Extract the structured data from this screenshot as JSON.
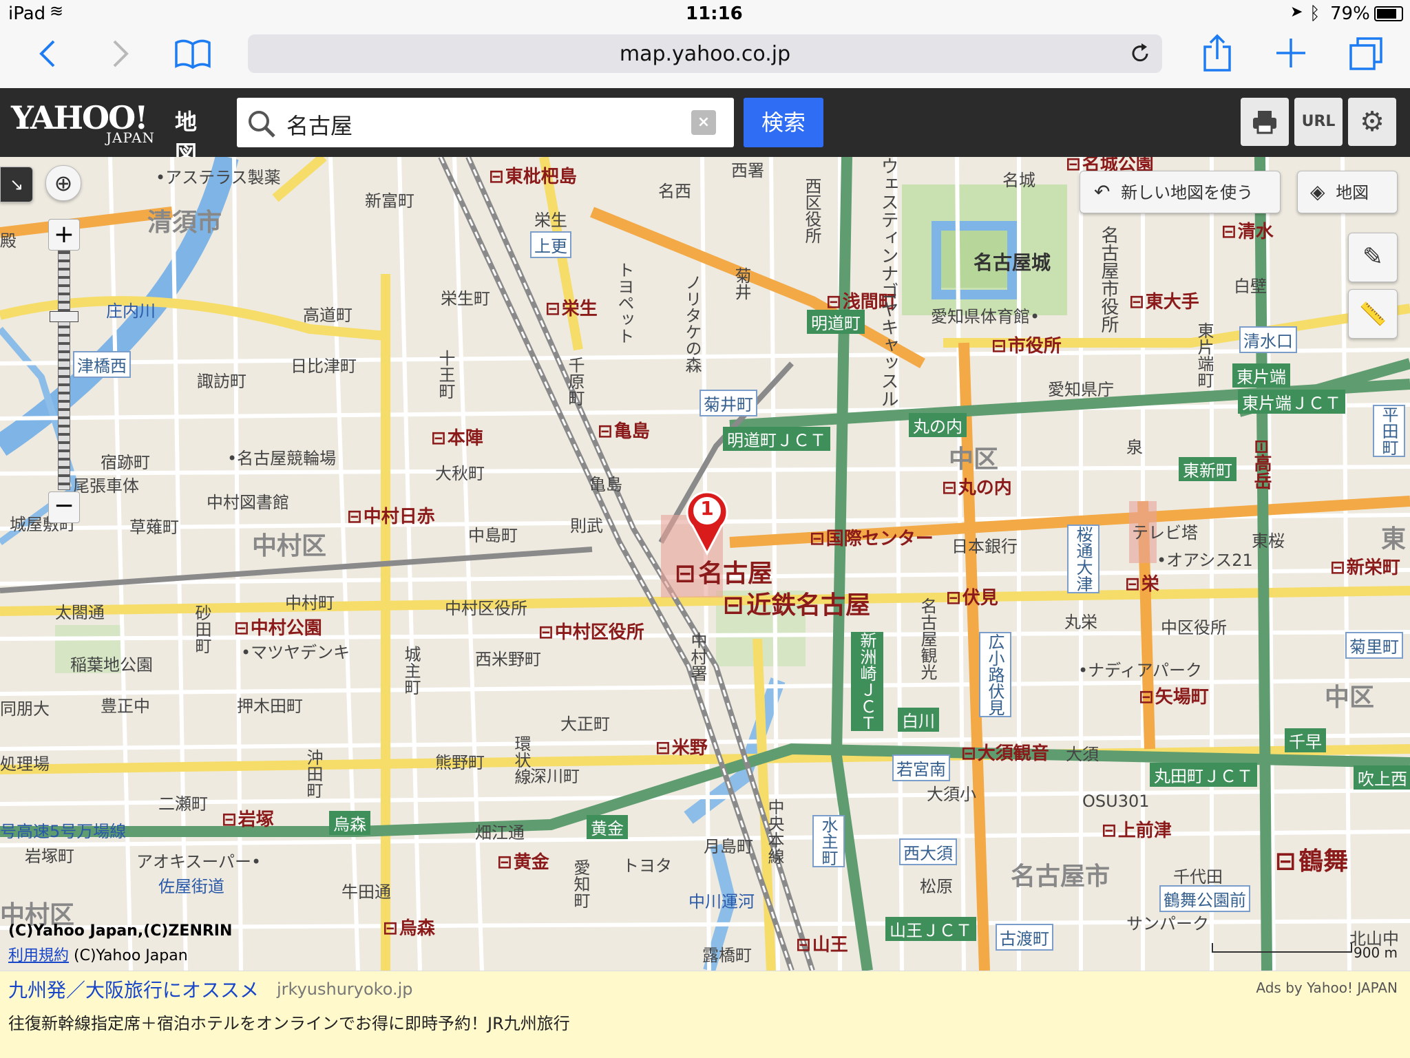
{
  "status_bar": {
    "device": "iPad",
    "time": "11:16",
    "battery": "79%"
  },
  "browser": {
    "url": "map.yahoo.co.jp"
  },
  "header": {
    "logo": "YAHOO!",
    "logo_sub": "JAPAN",
    "logo_service": "地図",
    "search_value": "名古屋",
    "clear_label": "×",
    "search_button": "検索",
    "url_button": "URL"
  },
  "map": {
    "new_map_button": "新しい地図を使う",
    "layer_button": "地図",
    "marker_number": "1",
    "scale": "900 m",
    "copyright_1": "(C)Yahoo Japan,(C)ZENRIN",
    "terms_link": "利用規約",
    "copyright_2": "(C)Yahoo Japan",
    "labels": {
      "asteras": "•アステラス製薬",
      "higashi_biwajima": "東枇杷島",
      "kiyosu": "清須市",
      "shintomi": "新富町",
      "meisei": "名西",
      "eisei": "栄生",
      "kamisara": "上更",
      "nishiku_yakusho": "西区役所",
      "nishisho": "西署",
      "meijo": "名城",
      "shiroshirou": "名古屋城",
      "meijo_sta": "名城公園",
      "shimizu": "清水",
      "shirakabe": "白壁",
      "shimizuguchi": "清水口",
      "higashiote": "東大手",
      "shiyakusho": "市役所",
      "nagoya_shiyakusho": "名古屋市役所",
      "aichi_gym": "愛知県体育館•",
      "aichi_pref": "愛知県庁",
      "sengencho": "浅間町",
      "meidocho": "明道町",
      "eiseicho": "栄生町",
      "eisei_sta": "栄生",
      "takamichi": "高道町",
      "shonaigawa": "庄内川",
      "tsubashinishi": "津橋西",
      "hibitsu": "日比津町",
      "suwa": "諏訪町",
      "kikui": "菊井町",
      "kikui_v": "菊井",
      "noritake": "ノリタケの森",
      "toyopet": "トヨペット",
      "jujicho": "十王町",
      "senbara": "千原町",
      "honjin": "本陣",
      "kameshima_sta": "亀島",
      "kameshima": "亀島",
      "meidocho_jct": "明道町ＪＣＴ",
      "marunouchi": "丸の内",
      "marunouchi_sta": "丸の内",
      "naka_ku": "中区",
      "higashikataha": "東片端",
      "higashikataha_jct": "東片端ＪＣＴ",
      "shukuato": "宿跡町",
      "keirinjo": "•名古屋競輪場",
      "ohakicho": "大秋町",
      "owari_shatai": "尾張車体",
      "nakamura_lib": "中村図書館",
      "nakamura_nisseki": "中村日赤",
      "joyashiki": "城屋敷町",
      "kusanagi": "草薙町",
      "nakamura_ku": "中村区",
      "nakajima": "中島町",
      "norutake2": "則武",
      "nagoya_sta": "名古屋",
      "kintetsu": "近鉄名古屋",
      "kokusai": "国際センター",
      "nichigin": "日本銀行",
      "tv_tower": "テレビ塔",
      "oasis": "•オアシス21",
      "sakae": "栄",
      "higashi_shincho": "東新町",
      "shinsakae": "新栄町",
      "taikodori": "太閤通",
      "nakamura_koen": "中村公園",
      "matsuyadenki": "•マツヤデンキ",
      "nakamura_ku_yakusho": "中村区役所",
      "nakamura_ku_yakusho_sta": "中村区役所",
      "nishi_yoneno": "西米野町",
      "fushimi": "伏見",
      "marue": "丸栄",
      "naka_ku_yakusho": "中区役所",
      "nadya": "•ナディアパーク",
      "yabacho": "矢場町",
      "inaba": "稲葉地公園",
      "toyosho": "豊正中",
      "douhou": "同朋大",
      "oshikita": "押木田町",
      "taisho": "大正町",
      "yoneno": "米野",
      "shirakawa": "白川",
      "osu_kannon": "大須観音",
      "wakamiya": "若宮南",
      "osu": "大須",
      "osu_sho": "大須小",
      "osu301": "OSU301",
      "kamimaezu": "上前津",
      "marutacho_jct": "丸田町ＪＣＴ",
      "fukiage": "吹上西",
      "chihaya": "千早",
      "tsurumai": "鶴舞",
      "kumano": "熊野町",
      "fukagawa": "深川町",
      "iwatsuka": "岩塚",
      "karasumori": "烏森",
      "karasumori_sta": "烏森",
      "kogane": "黄金",
      "kogane_sta": "黄金",
      "hatae": "畑江通",
      "toyota": "トヨタ",
      "aoki": "アオキスーパー•",
      "sayakaido": "佐屋街道",
      "ushida": "牛田通",
      "iwatsukacho": "岩塚町",
      "manbacho": "号高速5号万場線",
      "tsukijima": "月島町",
      "nakagawa_unga": "中川運河",
      "tsuyuhashi": "露橋町",
      "sanno": "山王",
      "sanno_jct": "山王ＪＣＴ",
      "kotokuji": "古渡町",
      "nishiosu": "西大須",
      "matsubara": "松原",
      "nagoya_city": "名古屋市",
      "chiyoda": "千代田",
      "tsurumai_koen": "鶴舞公園前",
      "sunpark": "サンパーク",
      "kitayamanaka": "北山中",
      "tokiwa": "大須",
      "chuo_honsen": "中央本線",
      "kanjyo": "環状線",
      "aichi": "愛知町",
      "mizunushi": "水主町",
      "shinsu": "新洲崎ＪＣＴ",
      "hirokoji": "広小路伏見",
      "sakura": "桜通大津",
      "takaoka": "高岳",
      "hirata": "平田町",
      "kikusato": "菊里町",
      "higashi_sakura": "東桜",
      "nakamura_cho": "中村町",
      "kitanakamura": "中村署",
      "sunahada": "砂田町",
      "tsuhashi": "橋",
      "jouryo": "城主町",
      "okita": "沖田町",
      "nisecho": "二瀬町",
      "shotoku": "殿",
      "nakamura_west": "中村区",
      "yoshi": "処理場",
      "hanare": "泉",
      "higashi_naka": "中区",
      "nagoya_kanko": "名古屋観光",
      "westin": "ウェスティンナゴヤキャッスル",
      "higashi_kataha_v": "東片端町",
      "kita_ku": "東"
    }
  },
  "ad": {
    "title": "九州発／大阪旅行にオススメ",
    "domain": "jrkyushuryoko.jp",
    "by": "Ads by Yahoo! JAPAN",
    "desc": "往復新幹線指定席＋宿泊ホテルをオンラインでお得に即時予約！JR九州旅行"
  }
}
